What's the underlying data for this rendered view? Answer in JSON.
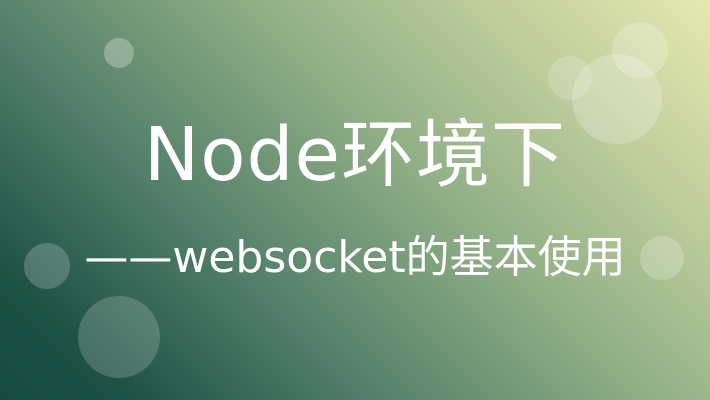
{
  "banner": {
    "title": "Node环境下",
    "subtitle": "——websocket的基本使用"
  },
  "colors": {
    "gradient_light": "#e6e8b0",
    "gradient_dark": "#174a3f",
    "text": "#ffffff"
  }
}
